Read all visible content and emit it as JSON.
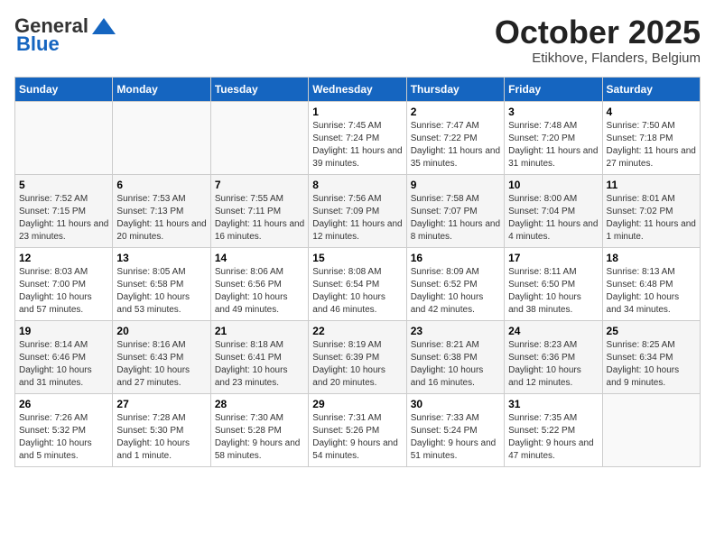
{
  "header": {
    "logo_line1": "General",
    "logo_line2": "Blue",
    "month": "October 2025",
    "location": "Etikhove, Flanders, Belgium"
  },
  "days_of_week": [
    "Sunday",
    "Monday",
    "Tuesday",
    "Wednesday",
    "Thursday",
    "Friday",
    "Saturday"
  ],
  "weeks": [
    [
      {
        "day": "",
        "info": ""
      },
      {
        "day": "",
        "info": ""
      },
      {
        "day": "",
        "info": ""
      },
      {
        "day": "1",
        "info": "Sunrise: 7:45 AM\nSunset: 7:24 PM\nDaylight: 11 hours and 39 minutes."
      },
      {
        "day": "2",
        "info": "Sunrise: 7:47 AM\nSunset: 7:22 PM\nDaylight: 11 hours and 35 minutes."
      },
      {
        "day": "3",
        "info": "Sunrise: 7:48 AM\nSunset: 7:20 PM\nDaylight: 11 hours and 31 minutes."
      },
      {
        "day": "4",
        "info": "Sunrise: 7:50 AM\nSunset: 7:18 PM\nDaylight: 11 hours and 27 minutes."
      }
    ],
    [
      {
        "day": "5",
        "info": "Sunrise: 7:52 AM\nSunset: 7:15 PM\nDaylight: 11 hours and 23 minutes."
      },
      {
        "day": "6",
        "info": "Sunrise: 7:53 AM\nSunset: 7:13 PM\nDaylight: 11 hours and 20 minutes."
      },
      {
        "day": "7",
        "info": "Sunrise: 7:55 AM\nSunset: 7:11 PM\nDaylight: 11 hours and 16 minutes."
      },
      {
        "day": "8",
        "info": "Sunrise: 7:56 AM\nSunset: 7:09 PM\nDaylight: 11 hours and 12 minutes."
      },
      {
        "day": "9",
        "info": "Sunrise: 7:58 AM\nSunset: 7:07 PM\nDaylight: 11 hours and 8 minutes."
      },
      {
        "day": "10",
        "info": "Sunrise: 8:00 AM\nSunset: 7:04 PM\nDaylight: 11 hours and 4 minutes."
      },
      {
        "day": "11",
        "info": "Sunrise: 8:01 AM\nSunset: 7:02 PM\nDaylight: 11 hours and 1 minute."
      }
    ],
    [
      {
        "day": "12",
        "info": "Sunrise: 8:03 AM\nSunset: 7:00 PM\nDaylight: 10 hours and 57 minutes."
      },
      {
        "day": "13",
        "info": "Sunrise: 8:05 AM\nSunset: 6:58 PM\nDaylight: 10 hours and 53 minutes."
      },
      {
        "day": "14",
        "info": "Sunrise: 8:06 AM\nSunset: 6:56 PM\nDaylight: 10 hours and 49 minutes."
      },
      {
        "day": "15",
        "info": "Sunrise: 8:08 AM\nSunset: 6:54 PM\nDaylight: 10 hours and 46 minutes."
      },
      {
        "day": "16",
        "info": "Sunrise: 8:09 AM\nSunset: 6:52 PM\nDaylight: 10 hours and 42 minutes."
      },
      {
        "day": "17",
        "info": "Sunrise: 8:11 AM\nSunset: 6:50 PM\nDaylight: 10 hours and 38 minutes."
      },
      {
        "day": "18",
        "info": "Sunrise: 8:13 AM\nSunset: 6:48 PM\nDaylight: 10 hours and 34 minutes."
      }
    ],
    [
      {
        "day": "19",
        "info": "Sunrise: 8:14 AM\nSunset: 6:46 PM\nDaylight: 10 hours and 31 minutes."
      },
      {
        "day": "20",
        "info": "Sunrise: 8:16 AM\nSunset: 6:43 PM\nDaylight: 10 hours and 27 minutes."
      },
      {
        "day": "21",
        "info": "Sunrise: 8:18 AM\nSunset: 6:41 PM\nDaylight: 10 hours and 23 minutes."
      },
      {
        "day": "22",
        "info": "Sunrise: 8:19 AM\nSunset: 6:39 PM\nDaylight: 10 hours and 20 minutes."
      },
      {
        "day": "23",
        "info": "Sunrise: 8:21 AM\nSunset: 6:38 PM\nDaylight: 10 hours and 16 minutes."
      },
      {
        "day": "24",
        "info": "Sunrise: 8:23 AM\nSunset: 6:36 PM\nDaylight: 10 hours and 12 minutes."
      },
      {
        "day": "25",
        "info": "Sunrise: 8:25 AM\nSunset: 6:34 PM\nDaylight: 10 hours and 9 minutes."
      }
    ],
    [
      {
        "day": "26",
        "info": "Sunrise: 7:26 AM\nSunset: 5:32 PM\nDaylight: 10 hours and 5 minutes."
      },
      {
        "day": "27",
        "info": "Sunrise: 7:28 AM\nSunset: 5:30 PM\nDaylight: 10 hours and 1 minute."
      },
      {
        "day": "28",
        "info": "Sunrise: 7:30 AM\nSunset: 5:28 PM\nDaylight: 9 hours and 58 minutes."
      },
      {
        "day": "29",
        "info": "Sunrise: 7:31 AM\nSunset: 5:26 PM\nDaylight: 9 hours and 54 minutes."
      },
      {
        "day": "30",
        "info": "Sunrise: 7:33 AM\nSunset: 5:24 PM\nDaylight: 9 hours and 51 minutes."
      },
      {
        "day": "31",
        "info": "Sunrise: 7:35 AM\nSunset: 5:22 PM\nDaylight: 9 hours and 47 minutes."
      },
      {
        "day": "",
        "info": ""
      }
    ]
  ]
}
